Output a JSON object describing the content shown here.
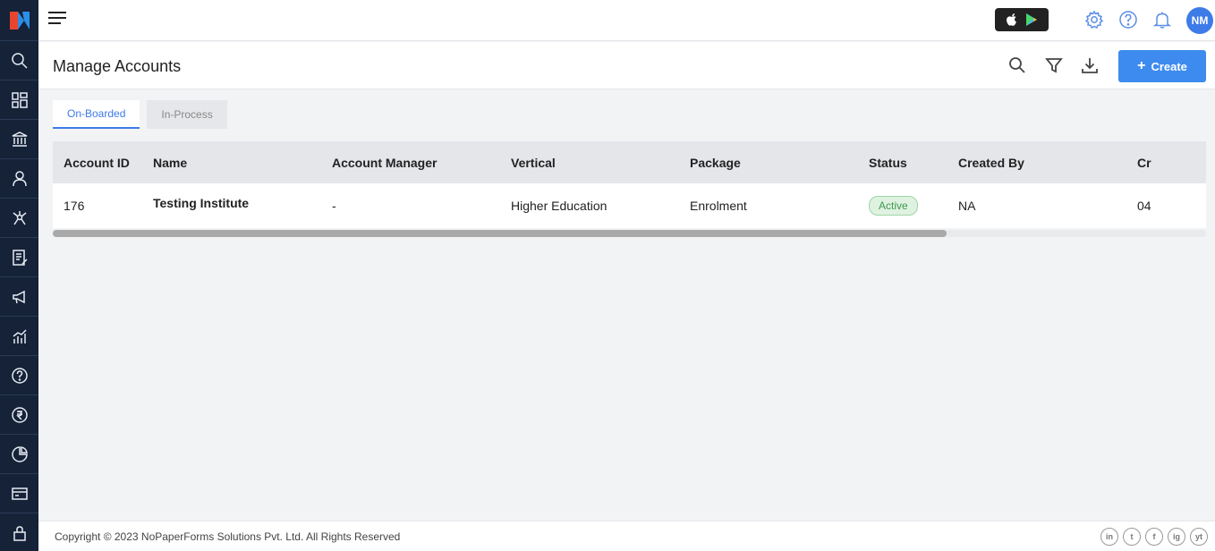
{
  "header": {
    "user_initials": "NM"
  },
  "page": {
    "title": "Manage Accounts",
    "create_label": "Create"
  },
  "tabs": [
    {
      "label": "On-Boarded",
      "active": true
    },
    {
      "label": "In-Process",
      "active": false
    }
  ],
  "table": {
    "columns": [
      "Account ID",
      "Name",
      "Account Manager",
      "Vertical",
      "Package",
      "Status",
      "Created By",
      "Cr"
    ],
    "rows": [
      {
        "account_id": "176",
        "name": "Testing Institute",
        "account_manager": "-",
        "vertical": "Higher Education",
        "package": "Enrolment",
        "status": "Active",
        "created_by": "NA",
        "created_on": "04"
      }
    ]
  },
  "footer": {
    "copyright": "Copyright © 2023 NoPaperForms Solutions Pvt. Ltd. All Rights Reserved",
    "social": [
      "in",
      "t",
      "f",
      "ig",
      "yt"
    ]
  },
  "colors": {
    "sidebar": "#152238",
    "accent": "#3d8bef",
    "status_active": "#3d9a4a"
  },
  "sidebar_icons": [
    "search-icon",
    "dashboard-icon",
    "institution-icon",
    "user-icon",
    "network-icon",
    "forms-icon",
    "campaign-icon",
    "analytics-icon",
    "help-icon",
    "rupee-icon",
    "pie-chart-icon",
    "billing-icon",
    "lock-icon"
  ]
}
